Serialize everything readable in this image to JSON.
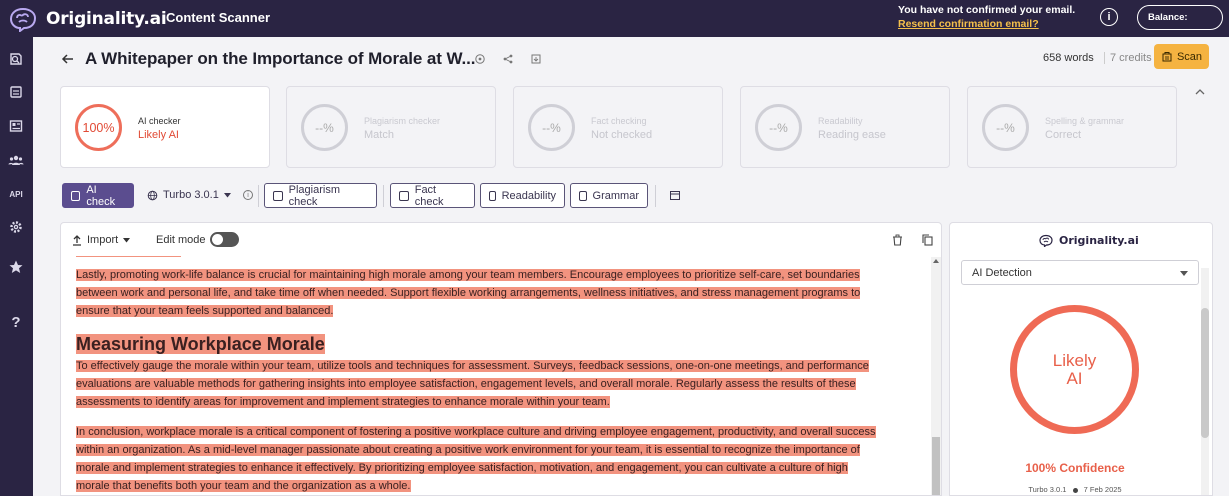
{
  "topbar": {
    "brand": "Originality.ai",
    "app_title": "Content Scanner",
    "email_notice": "You have not confirmed your email.",
    "resend_link": "Resend confirmation email?",
    "info_glyph": "i",
    "balance_label": "Balance:"
  },
  "sidebar": {
    "items": [
      {
        "icon": "scan-icon"
      },
      {
        "icon": "documents-icon"
      },
      {
        "icon": "news-icon"
      },
      {
        "icon": "team-icon"
      },
      {
        "icon": "api-icon",
        "label": "API"
      },
      {
        "icon": "settings-icon"
      },
      {
        "icon": "star-icon"
      },
      {
        "icon": "help-icon",
        "label": "?"
      }
    ]
  },
  "header": {
    "title": "A Whitepaper on the Importance of Morale at W...",
    "words": "658 words",
    "credits": "7 credits",
    "scan_label": "Scan"
  },
  "cards": [
    {
      "value": "100%",
      "label": "AI checker",
      "status": "Likely AI",
      "active": true
    },
    {
      "value": "--%",
      "label": "Plagiarism checker",
      "status": "Match",
      "active": false
    },
    {
      "value": "--%",
      "label": "Fact checking",
      "status": "Not checked",
      "active": false
    },
    {
      "value": "--%",
      "label": "Readability",
      "status": "Reading ease",
      "active": false
    },
    {
      "value": "--%",
      "label": "Spelling & grammar",
      "status": "Correct",
      "active": false
    }
  ],
  "toolbar": {
    "ai_check": "AI check",
    "model": "Turbo 3.0.1",
    "info_glyph": "i",
    "plagiarism": "Plagiarism check",
    "fact": "Fact check",
    "readability": "Readability",
    "grammar": "Grammar"
  },
  "editor": {
    "import_label": "Import",
    "edit_mode_label": "Edit mode",
    "content": [
      {
        "type": "para",
        "lines": [
          "Lastly, promoting work-life balance is crucial for maintaining high morale among your team members.  Encourage employees to prioritize self-care, set boundaries",
          "between work and personal life, and take time off when needed.  Support flexible working arrangements, wellness initiatives, and stress management programs to",
          "ensure that your team feels supported and balanced."
        ]
      },
      {
        "type": "heading",
        "text": "Measuring Workplace Morale"
      },
      {
        "type": "para",
        "lines": [
          "To effectively gauge the morale within your team, utilize tools and techniques for assessment.  Surveys, feedback sessions, one-on-one meetings, and performance",
          "evaluations are valuable methods for gathering insights into employee satisfaction, engagement levels, and overall morale.  Regularly assess the results of these",
          "assessments to identify areas for improvement and implement strategies to enhance morale within your team."
        ]
      },
      {
        "type": "para",
        "lines": [
          "In conclusion, workplace morale is a critical component of fostering a positive workplace culture and driving employee engagement, productivity, and overall success",
          "within an organization.  As a mid-level manager passionate about creating a positive work environment for your team, it is essential to recognize the importance of",
          "morale and implement strategies to enhance it effectively.  By prioritizing employee satisfaction, motivation, and engagement, you can cultivate a culture of high",
          "morale that benefits both your team and the organization as a whole."
        ]
      }
    ]
  },
  "panel": {
    "brand": "Originality.ai",
    "detection_select": "AI Detection",
    "result_line1": "Likely",
    "result_line2": "AI",
    "confidence": "100% Confidence",
    "model": "Turbo 3.0.1",
    "date": "7 Feb 2025"
  },
  "colors": {
    "nav_bg": "#2a2443",
    "accent": "#5b4d8f",
    "ai_red": "#e8604a",
    "highlight": "#f2937f",
    "scan_yellow": "#f5b341"
  }
}
